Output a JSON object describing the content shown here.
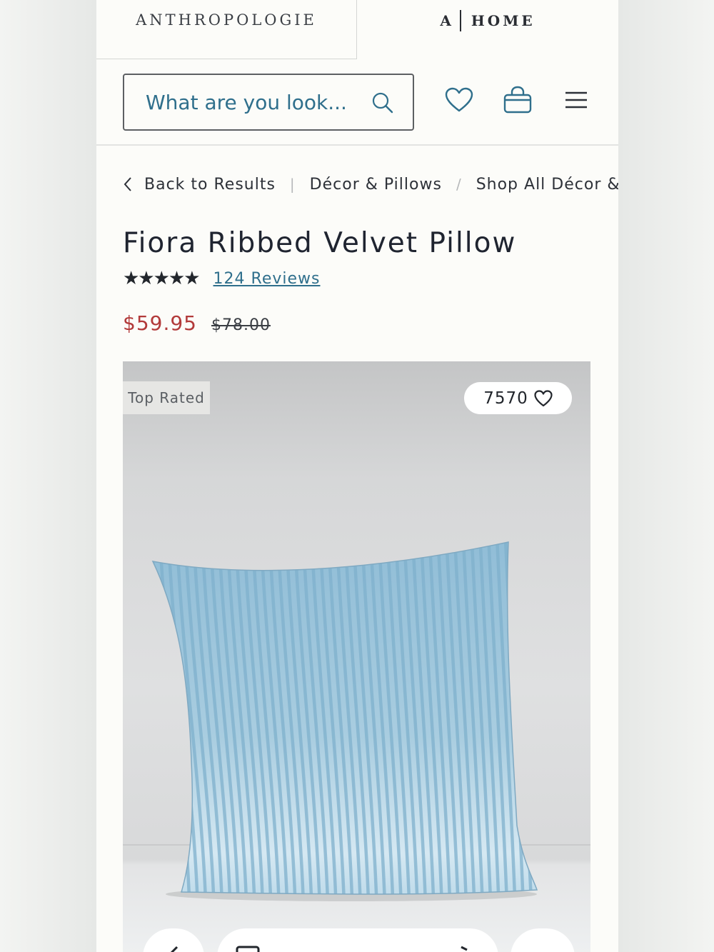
{
  "brand_tabs": {
    "anthropologie": "ANTHROPOLOGIE",
    "home_a": "A",
    "home_word": "HOME"
  },
  "header": {
    "search_placeholder": "What are you look...",
    "icons": [
      "search-icon",
      "heart-icon",
      "shopping-bag-icon",
      "menu-icon"
    ]
  },
  "breadcrumb": {
    "back": "Back to Results",
    "sep_pipe": "|",
    "category": "Décor & Pillows",
    "sep_slash": "/",
    "current": "Shop All Décor & Pillo"
  },
  "product": {
    "title": "Fiora Ribbed Velvet Pillow",
    "stars": "★★★★★",
    "rating_value": 5,
    "reviews": "124 Reviews",
    "sale_price": "$59.95",
    "original_price": "$78.00"
  },
  "image": {
    "badge": "Top Rated",
    "favorites_count": "7570",
    "pillow_color": "#a9cde0",
    "stripe_color": "#7fb0cc"
  },
  "colors": {
    "accent_link": "#2f6f8c",
    "sale_red": "#b23a3a",
    "page_bg": "#fcfcf9"
  }
}
